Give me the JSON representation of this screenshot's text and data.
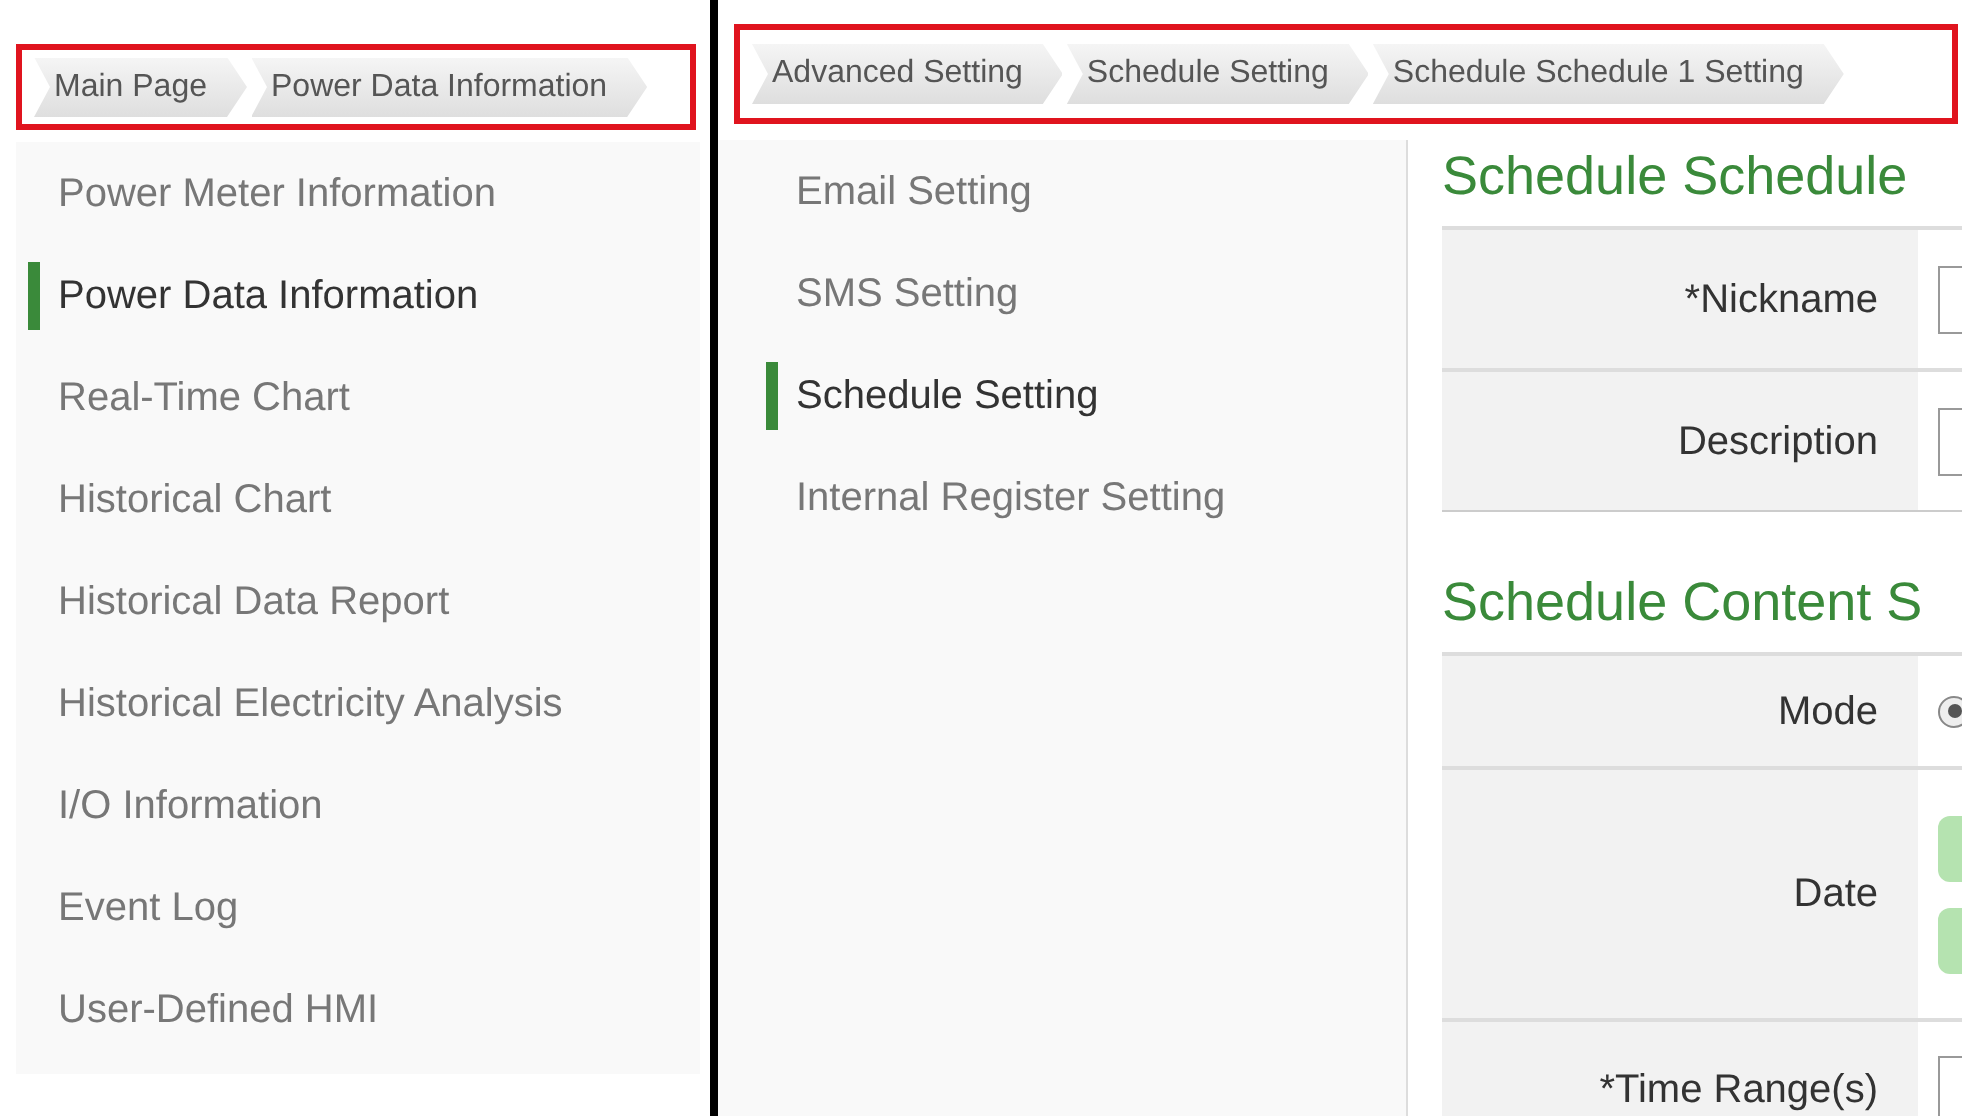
{
  "left_panel": {
    "breadcrumbs": [
      {
        "label": "Main Page"
      },
      {
        "label": "Power Data Information"
      }
    ],
    "sidebar": {
      "items": [
        {
          "label": "Power Meter Information",
          "selected": false
        },
        {
          "label": "Power Data Information",
          "selected": true
        },
        {
          "label": "Real-Time Chart",
          "selected": false
        },
        {
          "label": "Historical Chart",
          "selected": false
        },
        {
          "label": "Historical Data Report",
          "selected": false
        },
        {
          "label": "Historical Electricity Analysis",
          "selected": false
        },
        {
          "label": "I/O Information",
          "selected": false
        },
        {
          "label": "Event Log",
          "selected": false
        },
        {
          "label": "User-Defined HMI",
          "selected": false
        }
      ]
    }
  },
  "right_panel": {
    "breadcrumbs": [
      {
        "label": "Advanced Setting"
      },
      {
        "label": "Schedule Setting"
      },
      {
        "label": "Schedule Schedule 1 Setting"
      }
    ],
    "sidebar": {
      "items": [
        {
          "label": "Email Setting",
          "selected": false
        },
        {
          "label": "SMS Setting",
          "selected": false
        },
        {
          "label": "Schedule Setting",
          "selected": true
        },
        {
          "label": "Internal Register Setting",
          "selected": false
        }
      ]
    },
    "sections": [
      {
        "title": "Schedule Schedule",
        "rows": [
          {
            "kind": "text",
            "label": "*Nickname"
          },
          {
            "kind": "text",
            "label": "Description"
          }
        ]
      },
      {
        "title": "Schedule Content S",
        "rows": [
          {
            "kind": "radio",
            "label": "Mode",
            "checked": true
          },
          {
            "kind": "dates",
            "label": "Date"
          },
          {
            "kind": "text",
            "label": "*Time Range(s)"
          }
        ]
      }
    ]
  }
}
